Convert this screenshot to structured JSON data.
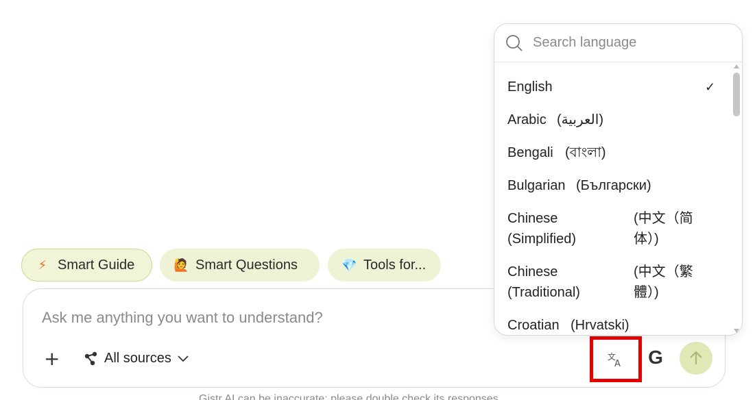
{
  "chips": {
    "guide": {
      "emoji": "⚡",
      "label": "Smart Guide"
    },
    "questions": {
      "emoji": "🙋",
      "label": "Smart Questions"
    },
    "tools": {
      "emoji": "💎",
      "label": "Tools for..."
    }
  },
  "composer": {
    "placeholder": "Ask me anything you want to understand?",
    "plus_label": "+",
    "sources_label": "All sources",
    "google_label": "G"
  },
  "disclaimer": "Gistr AI can be inaccurate; please double check its responses.",
  "language_menu": {
    "search_placeholder": "Search language",
    "selected": "English",
    "check": "✓",
    "items": [
      {
        "name": "English",
        "native": ""
      },
      {
        "name": "Arabic",
        "native": "(العربية)"
      },
      {
        "name": "Bengali",
        "native": "(বাংলা)"
      },
      {
        "name": "Bulgarian",
        "native": "(Български)"
      },
      {
        "name": "Chinese (Simplified)",
        "native": "(中文（简体）)"
      },
      {
        "name": "Chinese (Traditional)",
        "native": "(中文（繁體）)"
      },
      {
        "name": "Croatian",
        "native": "(Hrvatski)"
      }
    ]
  },
  "colors": {
    "chip_bg": "#eef3d6",
    "send_bg": "#dfe9b6",
    "highlight_border": "#e60000"
  }
}
